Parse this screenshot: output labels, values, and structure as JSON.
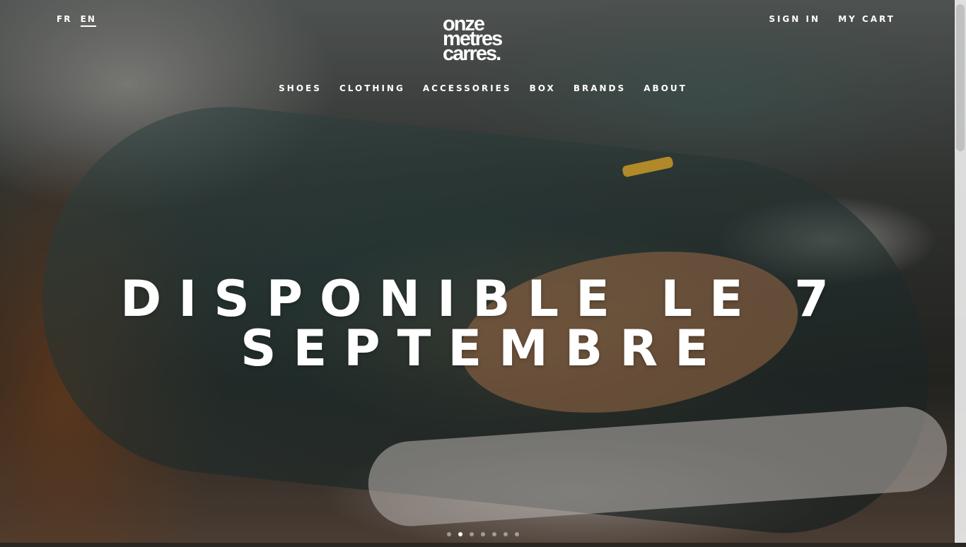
{
  "lang": {
    "fr": "FR",
    "en": "EN",
    "active": "EN"
  },
  "account": {
    "sign_in": "SIGN IN",
    "cart": "MY CART"
  },
  "logo": {
    "line1": "onze",
    "line2": "metres",
    "line3": "carres."
  },
  "nav": [
    "SHOES",
    "CLOTHING",
    "ACCESSORIES",
    "BOX",
    "BRANDS",
    "ABOUT"
  ],
  "hero": {
    "line1": "DISPONIBLE LE 7",
    "line2": "SEPTEMBRE",
    "image": "velvet-sneaker-photo"
  },
  "slider": {
    "count": 7,
    "active_index": 1
  },
  "colors": {
    "accent": "#ffffff",
    "lace_tip": "#d8a833"
  }
}
